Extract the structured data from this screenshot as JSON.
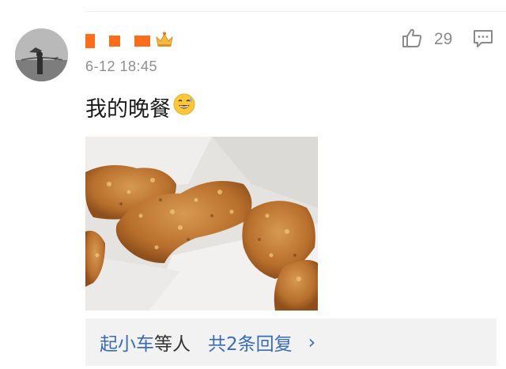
{
  "comment": {
    "username_emoji": "👑",
    "timestamp": "6-12 18:45",
    "text": "我的晚餐",
    "text_emoji": "😅",
    "likes": "29"
  },
  "replies": {
    "names": "起小车",
    "etc": "等人",
    "total_label": "共2条回复",
    "chevron": "›"
  },
  "icons": {
    "like": "thumbs-up-icon",
    "comment": "comment-icon",
    "crown": "crown-icon"
  },
  "colors": {
    "link_blue": "#3b6bb3",
    "username_orange": "#ff6d1b",
    "reply_bg": "#f2f2f2"
  }
}
